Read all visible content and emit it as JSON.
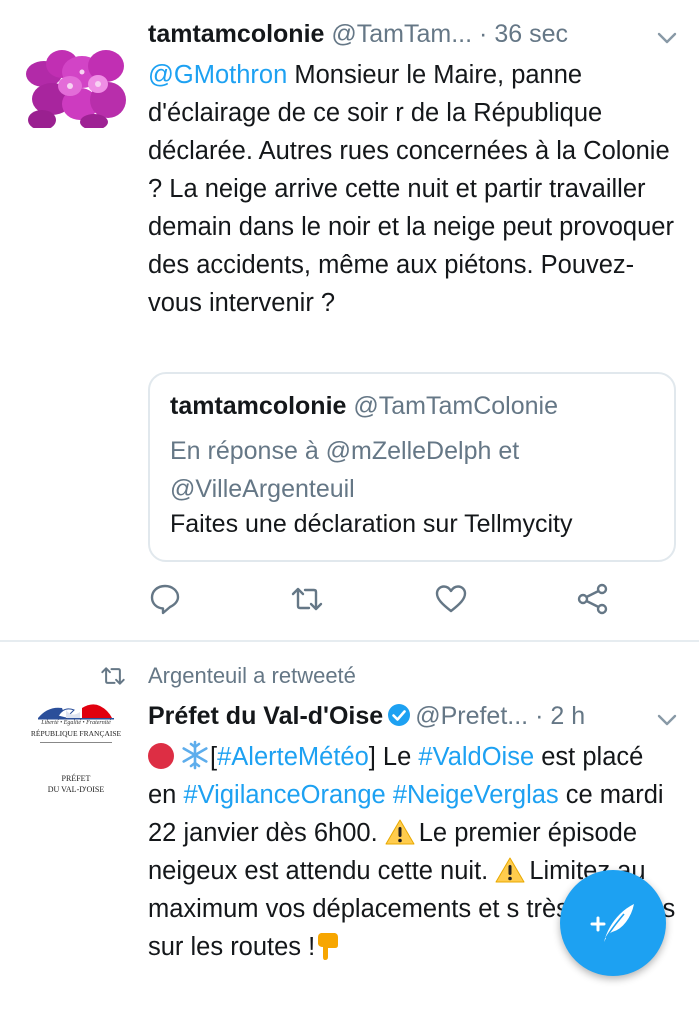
{
  "tweets": [
    {
      "author_name": "tamtamcolonie",
      "author_handle": "@TamTam...",
      "separator": "·",
      "time": "36 sec",
      "mention": "@GMothron",
      "text": " Monsieur le Maire, panne d'éclairage de ce soir r de la République déclarée. Autres rues concernées à la Colonie ? La neige arrive cette nuit et partir travailler demain dans le noir et la neige peut provoquer des accidents, même aux piétons. Pouvez-vous intervenir ?",
      "quoted": {
        "author_name": "tamtamcolonie",
        "author_handle": "@TamTamColonie",
        "reply_line1": "En réponse à @mZelleDelph et",
        "reply_line2": "@VilleArgenteuil",
        "text": "Faites une déclaration sur Tellmycity"
      },
      "icons": [
        "reply-icon",
        "retweet-icon",
        "like-icon",
        "share-icon"
      ]
    },
    {
      "retweeted_by": "Argenteuil a retweeté",
      "author_name": "Préfet du Val-d'Oise",
      "author_handle": "@Prefet...",
      "separator": "·",
      "time": "2 h",
      "verified": true,
      "avatar_text": {
        "motto": "Liberté • Égalité • Fraternité",
        "republic": "RÉPUBLIQUE FRANÇAISE",
        "line1": "PRÉFET",
        "line2": "DU VAL-D'OISE"
      },
      "body": {
        "bracket_open": "[",
        "tag1": "#AlerteMétéo",
        "bracket_close": "] Le ",
        "tag2": "#ValdOise",
        "text1": " est placé en ",
        "tag3": "#VigilanceOrange",
        "tag4": "#NeigeVerglas",
        "text2": " ce mardi 22 janvier dès 6h00. ",
        "text3": "Le premier épisode neigeux est attendu cette nuit. ",
        "text4": "Limitez au maximum vos déplacements et s très prudents sur les routes !"
      }
    }
  ],
  "fab": {
    "icon": "compose-tweet-icon"
  },
  "colors": {
    "accent": "#1da1f2",
    "text": "#14171a",
    "secondary": "#657786",
    "border": "#e1e8ed"
  }
}
